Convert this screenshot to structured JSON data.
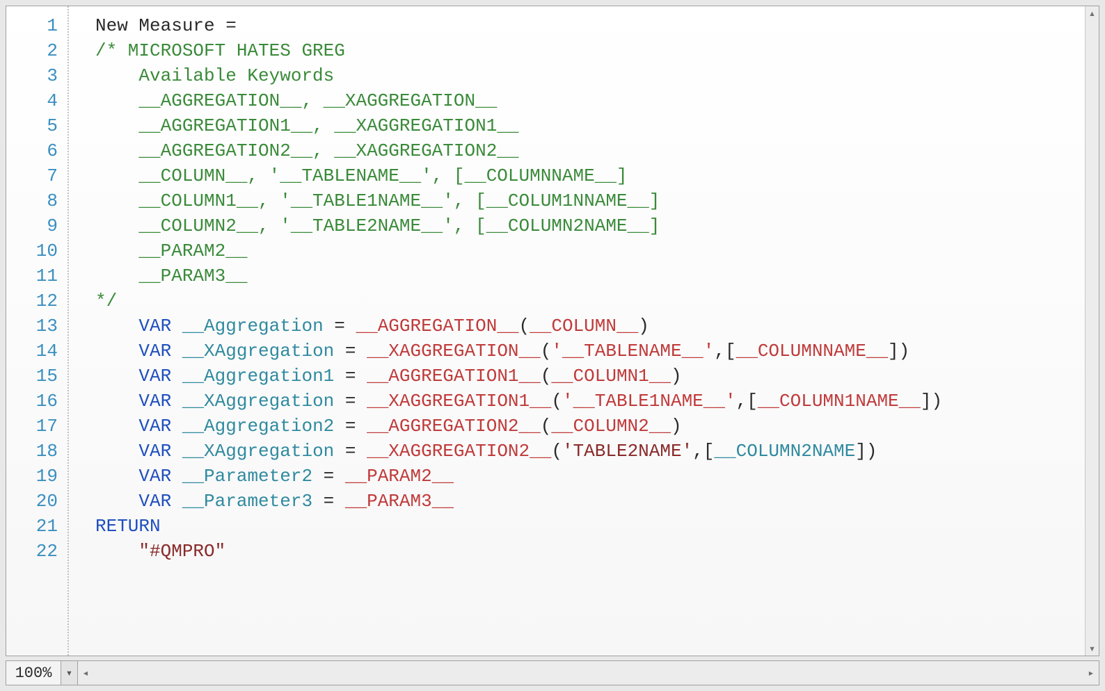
{
  "zoom": "100%",
  "lineCount": 22,
  "lines": [
    [
      {
        "cls": "tk-default",
        "t": "New Measure ="
      }
    ],
    [
      {
        "cls": "tk-comment",
        "t": "/* MICROSOFT HATES GREG"
      }
    ],
    [
      {
        "cls": "tk-comment",
        "t": "    Available Keywords"
      }
    ],
    [
      {
        "cls": "tk-comment",
        "t": "    __AGGREGATION__, __XAGGREGATION__"
      }
    ],
    [
      {
        "cls": "tk-comment",
        "t": "    __AGGREGATION1__, __XAGGREGATION1__"
      }
    ],
    [
      {
        "cls": "tk-comment",
        "t": "    __AGGREGATION2__, __XAGGREGATION2__"
      }
    ],
    [
      {
        "cls": "tk-comment",
        "t": "    __COLUMN__, '__TABLENAME__', [__COLUMNNAME__]"
      }
    ],
    [
      {
        "cls": "tk-comment",
        "t": "    __COLUMN1__, '__TABLE1NAME__', [__COLUM1NNAME__]"
      }
    ],
    [
      {
        "cls": "tk-comment",
        "t": "    __COLUMN2__, '__TABLE2NAME__', [__COLUMN2NAME__]"
      }
    ],
    [
      {
        "cls": "tk-comment",
        "t": "    __PARAM2__"
      }
    ],
    [
      {
        "cls": "tk-comment",
        "t": "    __PARAM3__"
      }
    ],
    [
      {
        "cls": "tk-comment",
        "t": "*/"
      }
    ],
    [
      {
        "cls": "tk-default",
        "t": "    "
      },
      {
        "cls": "tk-var",
        "t": "VAR "
      },
      {
        "cls": "tk-ident",
        "t": "__Aggregation"
      },
      {
        "cls": "tk-default",
        "t": " = "
      },
      {
        "cls": "tk-func",
        "t": "__AGGREGATION__"
      },
      {
        "cls": "tk-default",
        "t": "("
      },
      {
        "cls": "tk-func",
        "t": "__COLUMN__"
      },
      {
        "cls": "tk-default",
        "t": ")"
      }
    ],
    [
      {
        "cls": "tk-default",
        "t": "    "
      },
      {
        "cls": "tk-var",
        "t": "VAR "
      },
      {
        "cls": "tk-ident",
        "t": "__XAggregation"
      },
      {
        "cls": "tk-default",
        "t": " = "
      },
      {
        "cls": "tk-func",
        "t": "__XAGGREGATION__"
      },
      {
        "cls": "tk-default",
        "t": "("
      },
      {
        "cls": "tk-func",
        "t": "'__TABLENAME__'"
      },
      {
        "cls": "tk-default",
        "t": ",["
      },
      {
        "cls": "tk-func",
        "t": "__COLUMNNAME__"
      },
      {
        "cls": "tk-default",
        "t": "])"
      }
    ],
    [
      {
        "cls": "tk-default",
        "t": "    "
      },
      {
        "cls": "tk-var",
        "t": "VAR "
      },
      {
        "cls": "tk-ident",
        "t": "__Aggregation1"
      },
      {
        "cls": "tk-default",
        "t": " = "
      },
      {
        "cls": "tk-func",
        "t": "__AGGREGATION1__"
      },
      {
        "cls": "tk-default",
        "t": "("
      },
      {
        "cls": "tk-func",
        "t": "__COLUMN1__"
      },
      {
        "cls": "tk-default",
        "t": ")"
      }
    ],
    [
      {
        "cls": "tk-default",
        "t": "    "
      },
      {
        "cls": "tk-var",
        "t": "VAR "
      },
      {
        "cls": "tk-ident",
        "t": "__XAggregation"
      },
      {
        "cls": "tk-default",
        "t": " = "
      },
      {
        "cls": "tk-func",
        "t": "__XAGGREGATION1__"
      },
      {
        "cls": "tk-default",
        "t": "("
      },
      {
        "cls": "tk-func",
        "t": "'__TABLE1NAME__'"
      },
      {
        "cls": "tk-default",
        "t": ",["
      },
      {
        "cls": "tk-func",
        "t": "__COLUMN1NAME__"
      },
      {
        "cls": "tk-default",
        "t": "])"
      }
    ],
    [
      {
        "cls": "tk-default",
        "t": "    "
      },
      {
        "cls": "tk-var",
        "t": "VAR "
      },
      {
        "cls": "tk-ident",
        "t": "__Aggregation2"
      },
      {
        "cls": "tk-default",
        "t": " = "
      },
      {
        "cls": "tk-func",
        "t": "__AGGREGATION2__"
      },
      {
        "cls": "tk-default",
        "t": "("
      },
      {
        "cls": "tk-func",
        "t": "__COLUMN2__"
      },
      {
        "cls": "tk-default",
        "t": ")"
      }
    ],
    [
      {
        "cls": "tk-default",
        "t": "    "
      },
      {
        "cls": "tk-var",
        "t": "VAR "
      },
      {
        "cls": "tk-ident",
        "t": "__XAggregation"
      },
      {
        "cls": "tk-default",
        "t": " = "
      },
      {
        "cls": "tk-func",
        "t": "__XAGGREGATION2__"
      },
      {
        "cls": "tk-default",
        "t": "("
      },
      {
        "cls": "tk-string",
        "t": "'TABLE2NAME'"
      },
      {
        "cls": "tk-default",
        "t": ",["
      },
      {
        "cls": "tk-ident",
        "t": "__COLUMN2NAME"
      },
      {
        "cls": "tk-default",
        "t": "])"
      }
    ],
    [
      {
        "cls": "tk-default",
        "t": "    "
      },
      {
        "cls": "tk-var",
        "t": "VAR "
      },
      {
        "cls": "tk-ident",
        "t": "__Parameter2"
      },
      {
        "cls": "tk-default",
        "t": " = "
      },
      {
        "cls": "tk-func",
        "t": "__PARAM2__"
      }
    ],
    [
      {
        "cls": "tk-default",
        "t": "    "
      },
      {
        "cls": "tk-var",
        "t": "VAR "
      },
      {
        "cls": "tk-ident",
        "t": "__Parameter3"
      },
      {
        "cls": "tk-default",
        "t": " = "
      },
      {
        "cls": "tk-func",
        "t": "__PARAM3__"
      }
    ],
    [
      {
        "cls": "tk-keyword",
        "t": "RETURN"
      }
    ],
    [
      {
        "cls": "tk-default",
        "t": "    "
      },
      {
        "cls": "tk-string",
        "t": "\"#QMPRO\""
      }
    ]
  ]
}
